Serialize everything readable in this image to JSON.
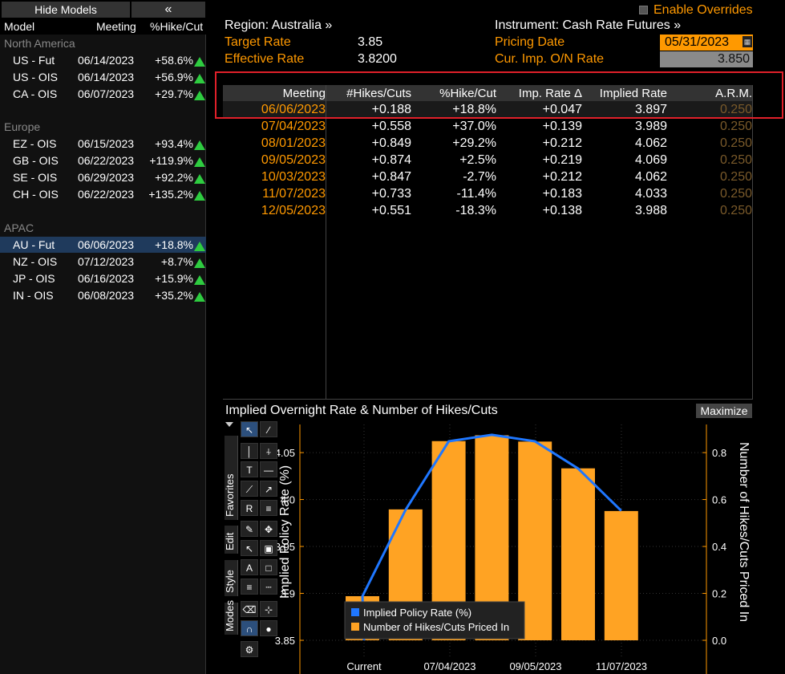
{
  "left_panel": {
    "hide_button": "Hide Models",
    "collapse_button": "«",
    "headers": {
      "model": "Model",
      "meeting": "Meeting",
      "hike": "%Hike/Cut"
    },
    "groups": [
      {
        "name": "North America",
        "rows": [
          {
            "model": "US - Fut",
            "meeting": "06/14/2023",
            "hike": "+58.6%"
          },
          {
            "model": "US - OIS",
            "meeting": "06/14/2023",
            "hike": "+56.9%"
          },
          {
            "model": "CA - OIS",
            "meeting": "06/07/2023",
            "hike": "+29.7%"
          }
        ]
      },
      {
        "name": "Europe",
        "rows": [
          {
            "model": "EZ - OIS",
            "meeting": "06/15/2023",
            "hike": "+93.4%"
          },
          {
            "model": "GB - OIS",
            "meeting": "06/22/2023",
            "hike": "+119.9%"
          },
          {
            "model": "SE - OIS",
            "meeting": "06/29/2023",
            "hike": "+92.2%"
          },
          {
            "model": "CH - OIS",
            "meeting": "06/22/2023",
            "hike": "+135.2%"
          }
        ]
      },
      {
        "name": "APAC",
        "rows": [
          {
            "model": "AU - Fut",
            "meeting": "06/06/2023",
            "hike": "+18.8%"
          },
          {
            "model": "NZ - OIS",
            "meeting": "07/12/2023",
            "hike": "+8.7%"
          },
          {
            "model": "JP - OIS",
            "meeting": "06/16/2023",
            "hike": "+15.9%"
          },
          {
            "model": "IN - OIS",
            "meeting": "06/08/2023",
            "hike": "+35.2%"
          }
        ]
      }
    ]
  },
  "info": {
    "region": "Region: Australia »",
    "instrument": "Instrument: Cash Rate Futures »",
    "enable_overrides": "Enable Overrides",
    "target_rate_label": "Target Rate",
    "target_rate_value": "3.85",
    "effective_rate_label": "Effective Rate",
    "effective_rate_value": "3.8200",
    "pricing_date_label": "Pricing Date",
    "pricing_date_value": "05/31/2023",
    "overnight_label": "Cur. Imp. O/N Rate",
    "overnight_value": "3.850"
  },
  "table": {
    "headers": [
      "Meeting",
      "#Hikes/Cuts",
      "%Hike/Cut",
      "Imp. Rate Δ",
      "Implied Rate",
      "A.R.M."
    ],
    "rows": [
      [
        "06/06/2023",
        "+0.188",
        "+18.8%",
        "+0.047",
        "3.897",
        "0.250"
      ],
      [
        "07/04/2023",
        "+0.558",
        "+37.0%",
        "+0.139",
        "3.989",
        "0.250"
      ],
      [
        "08/01/2023",
        "+0.849",
        "+29.2%",
        "+0.212",
        "4.062",
        "0.250"
      ],
      [
        "09/05/2023",
        "+0.874",
        "+2.5%",
        "+0.219",
        "4.069",
        "0.250"
      ],
      [
        "10/03/2023",
        "+0.847",
        "-2.7%",
        "+0.212",
        "4.062",
        "0.250"
      ],
      [
        "11/07/2023",
        "+0.733",
        "-11.4%",
        "+0.183",
        "4.033",
        "0.250"
      ],
      [
        "12/05/2023",
        "+0.551",
        "-18.3%",
        "+0.138",
        "3.988",
        "0.250"
      ]
    ]
  },
  "chart": {
    "title": "Implied Overnight Rate & Number of Hikes/Cuts",
    "maximize": "Maximize",
    "tabs": [
      "Favorites",
      "Edit",
      "Style",
      "Modes"
    ],
    "tool_icons": [
      "pointer-icon",
      "pen-icon",
      "vertical-line-icon",
      "percent-line-icon",
      "text-icon",
      "horizontal-line-icon",
      "trend-icon",
      "ray-icon",
      "r-icon",
      "fib-icon",
      "brush-icon",
      "move-icon",
      "add-cursor-icon",
      "trash-icon",
      "font-icon",
      "fill-icon",
      "line-weight-icon",
      "line-style-icon",
      "eraser-icon",
      "crosshair-icon",
      "magnet-icon",
      "color-icon",
      "gear-icon"
    ]
  },
  "chart_data": {
    "type": "bar",
    "title": "Implied Overnight Rate & Number of Hikes/Cuts",
    "x_tick_labels": [
      "Current",
      "07/04/2023",
      "09/05/2023",
      "11/07/2023"
    ],
    "categories": [
      "Current",
      "06/06/2023",
      "07/04/2023",
      "08/01/2023",
      "09/05/2023",
      "10/03/2023",
      "11/07/2023",
      "12/05/2023"
    ],
    "ylabel": "Implied Policy Rate (%)",
    "y2label": "Number of Hikes/Cuts Priced In",
    "ylim": [
      3.85,
      4.08
    ],
    "y2lim": [
      0,
      0.92
    ],
    "y_ticks": [
      3.85,
      3.9,
      3.95,
      4.0,
      4.05
    ],
    "y2_ticks": [
      0.0,
      0.2,
      0.4,
      0.6,
      0.8
    ],
    "legend_position": "bottom-left",
    "grid": true,
    "series": [
      {
        "name": "Implied Policy Rate (%)",
        "type": "line",
        "color": "#1f77ff",
        "values": [
          3.85,
          3.897,
          3.989,
          4.062,
          4.069,
          4.062,
          4.033,
          3.988
        ]
      },
      {
        "name": "Number of Hikes/Cuts Priced In",
        "type": "bar",
        "color": "#ffa323",
        "values": [
          null,
          0.188,
          0.558,
          0.849,
          0.874,
          0.847,
          0.733,
          0.551
        ]
      }
    ]
  }
}
